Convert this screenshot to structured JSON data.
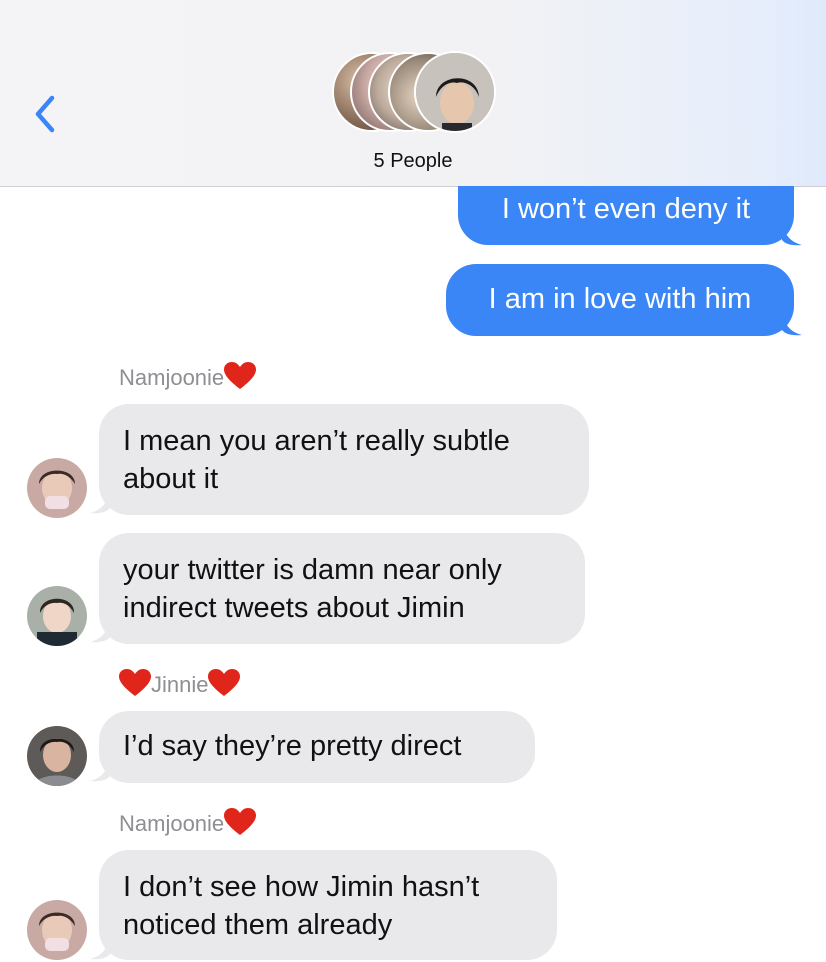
{
  "header": {
    "back_icon": "chevron-left-icon",
    "subtitle": "5 People",
    "accent_color": "#3a86f7"
  },
  "messages": [
    {
      "direction": "outgoing",
      "text": "I won’t even deny it"
    },
    {
      "direction": "outgoing",
      "text": "I am in love with him"
    },
    {
      "direction": "incoming",
      "sender": "Namjoonie",
      "text": "I mean you aren’t really subtle about it"
    },
    {
      "direction": "incoming",
      "text": "your twitter is damn near only indirect tweets about Jimin"
    },
    {
      "direction": "incoming",
      "sender": "Jinnie",
      "text": "I’d say they’re pretty direct"
    },
    {
      "direction": "incoming",
      "sender": "Namjoonie",
      "text": "I don’t see how Jimin hasn’t noticed them already"
    }
  ],
  "colors": {
    "outgoing_bubble": "#3a86f7",
    "incoming_bubble": "#e9e9eb",
    "heart": "#e0261b"
  }
}
